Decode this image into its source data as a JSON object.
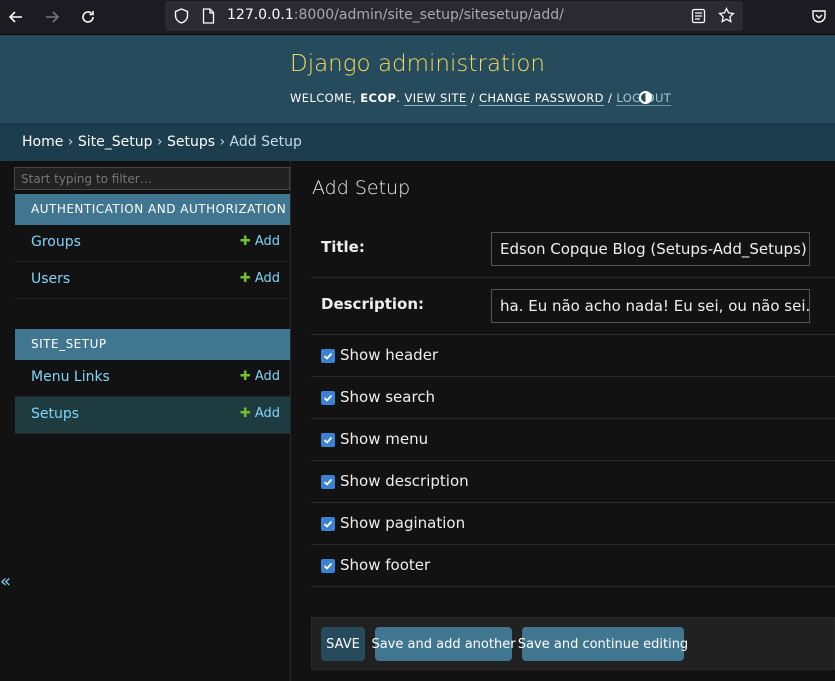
{
  "browser": {
    "url_host": "127.0.0.1",
    "url_rest": ":8000/admin/site_setup/sitesetup/add/"
  },
  "header": {
    "branding": "Django administration",
    "welcome": "WELCOME, ",
    "username": "ECOP",
    "sep1": ". ",
    "view_site": "VIEW SITE",
    "sep2": " / ",
    "change_password": "CHANGE PASSWORD",
    "sep3": " / ",
    "logout": "LOG OUT"
  },
  "breadcrumbs": {
    "home": "Home",
    "app": "Site_Setup",
    "model": "Setups",
    "current": "Add Setup",
    "separator": " › "
  },
  "sidebar": {
    "filter_placeholder": "Start typing to filter…",
    "modules": [
      {
        "caption": "AUTHENTICATION AND AUTHORIZATION",
        "rows": [
          {
            "name": "Groups",
            "add": "Add"
          },
          {
            "name": "Users",
            "add": "Add"
          }
        ]
      },
      {
        "caption": "SITE_SETUP",
        "rows": [
          {
            "name": "Menu Links",
            "add": "Add"
          },
          {
            "name": "Setups",
            "add": "Add"
          }
        ]
      }
    ],
    "collapse": "«"
  },
  "main": {
    "title": "Add Setup",
    "fields": {
      "title_label": "Title:",
      "title_value": "Edson Copque Blog (Setups-Add_Setups)",
      "description_label": "Description:",
      "description_value": "ha. Eu não acho nada! Eu sei, ou não sei. EC"
    },
    "checkboxes": [
      {
        "label": "Show header",
        "checked": true
      },
      {
        "label": "Show search",
        "checked": true
      },
      {
        "label": "Show menu",
        "checked": true
      },
      {
        "label": "Show description",
        "checked": true
      },
      {
        "label": "Show pagination",
        "checked": true
      },
      {
        "label": "Show footer",
        "checked": true
      }
    ],
    "buttons": {
      "save": "SAVE",
      "save_add_another": "Save and add another",
      "save_continue": "Save and continue editing"
    }
  }
}
